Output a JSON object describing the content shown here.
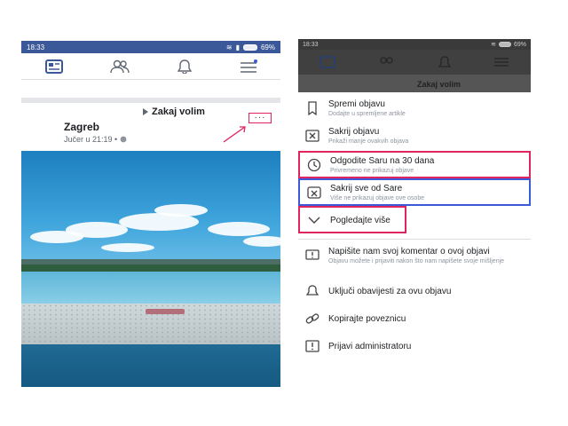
{
  "left": {
    "status": {
      "time": "18:33",
      "battery": "69%"
    },
    "post": {
      "page_name": "Zakaj volim",
      "place": "Zagreb",
      "time": "Jučer u 21:19 •",
      "more_label": "···"
    }
  },
  "right": {
    "status": {
      "time": "18:33",
      "battery": "69%"
    },
    "faded_title": "Zakaj volim",
    "menu": [
      {
        "title": "Spremi objavu",
        "subtitle": "Dodajte u spremljene artikle",
        "icon": "bookmark-icon"
      },
      {
        "title": "Sakrij objavu",
        "subtitle": "Prikaži manje ovakvih objava",
        "icon": "hide-post-icon"
      },
      {
        "title": "Odgodite Saru na 30 dana",
        "subtitle": "Privremeno ne prikazuj objave",
        "icon": "clock-icon"
      },
      {
        "title": "Sakrij sve od Sare",
        "subtitle": "Više ne prikazuj objave ove osobe",
        "icon": "hide-all-icon"
      },
      {
        "title": "Pogledajte više",
        "subtitle": "",
        "icon": "chevron-down-icon"
      },
      {
        "title": "Napišite nam svoj komentar o ovoj objavi",
        "subtitle": "Objavu možete i prijaviti nakon što nam napišete svoje mišljenje",
        "icon": "feedback-icon"
      },
      {
        "title": "Uključi obavijesti za ovu objavu",
        "subtitle": "",
        "icon": "bell-icon"
      },
      {
        "title": "Kopirajte poveznicu",
        "subtitle": "",
        "icon": "link-icon"
      },
      {
        "title": "Prijavi administratoru",
        "subtitle": "",
        "icon": "report-icon"
      }
    ]
  },
  "colors": {
    "facebook_blue": "#3b5998",
    "highlight_red": "#e0245e",
    "highlight_blue": "#3b5ad8"
  }
}
